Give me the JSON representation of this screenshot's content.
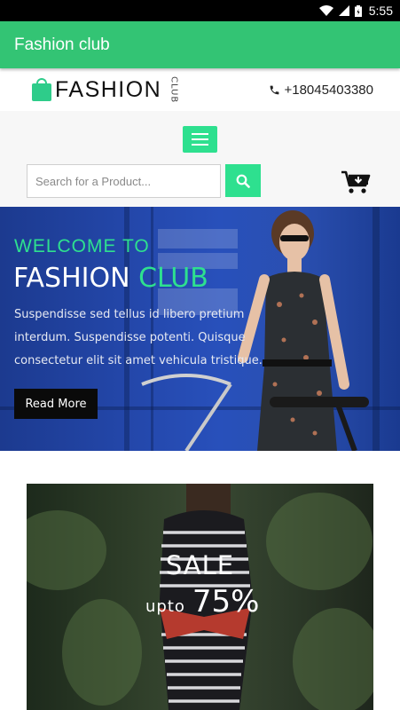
{
  "status_bar": {
    "time": "5:55",
    "icons": [
      "wifi-icon",
      "signal-icon",
      "battery-icon"
    ]
  },
  "app_bar": {
    "title": "Fashion club",
    "color": "#33c474"
  },
  "header": {
    "logo_text": "FASHION",
    "logo_sub": "CLUB",
    "phone": "+18045403380"
  },
  "nav": {
    "accent_color": "#2ee08f",
    "menu_icon": "hamburger-menu-icon",
    "search": {
      "placeholder": "Search for a Product...",
      "value": ""
    },
    "search_icon": "search-icon",
    "cart_icon": "cart-icon"
  },
  "hero": {
    "welcome": "WELCOME TO",
    "title_main": "FASHION",
    "title_accent": "CLUB",
    "description": "Suspendisse sed tellus id libero pretium interdum. Suspendisse potenti. Quisque consectetur elit sit amet vehicula tristique.",
    "button_label": "Read More"
  },
  "sale": {
    "title": "SALE",
    "upto": "upto",
    "percent": "75%"
  }
}
